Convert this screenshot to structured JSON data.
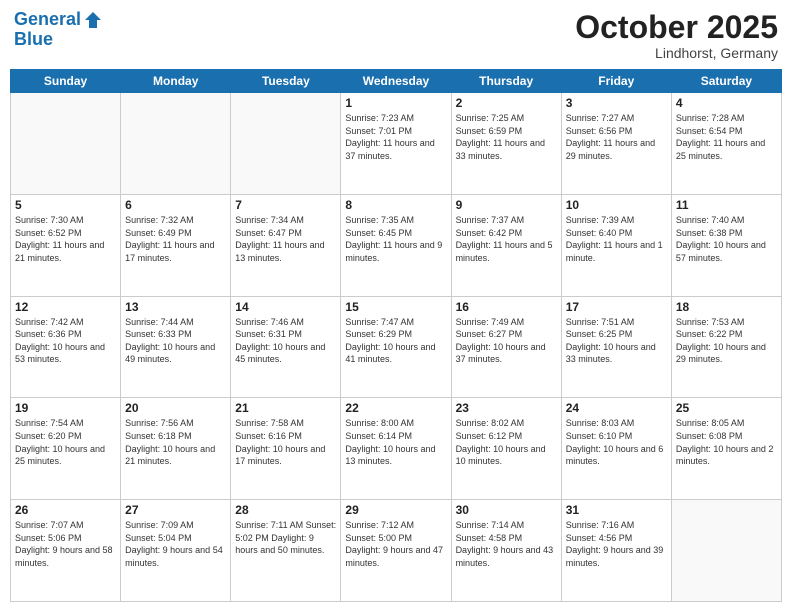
{
  "header": {
    "logo_line1": "General",
    "logo_line2": "Blue",
    "month": "October 2025",
    "location": "Lindhorst, Germany"
  },
  "days_of_week": [
    "Sunday",
    "Monday",
    "Tuesday",
    "Wednesday",
    "Thursday",
    "Friday",
    "Saturday"
  ],
  "weeks": [
    [
      {
        "day": "",
        "info": ""
      },
      {
        "day": "",
        "info": ""
      },
      {
        "day": "",
        "info": ""
      },
      {
        "day": "1",
        "info": "Sunrise: 7:23 AM\nSunset: 7:01 PM\nDaylight: 11 hours\nand 37 minutes."
      },
      {
        "day": "2",
        "info": "Sunrise: 7:25 AM\nSunset: 6:59 PM\nDaylight: 11 hours\nand 33 minutes."
      },
      {
        "day": "3",
        "info": "Sunrise: 7:27 AM\nSunset: 6:56 PM\nDaylight: 11 hours\nand 29 minutes."
      },
      {
        "day": "4",
        "info": "Sunrise: 7:28 AM\nSunset: 6:54 PM\nDaylight: 11 hours\nand 25 minutes."
      }
    ],
    [
      {
        "day": "5",
        "info": "Sunrise: 7:30 AM\nSunset: 6:52 PM\nDaylight: 11 hours\nand 21 minutes."
      },
      {
        "day": "6",
        "info": "Sunrise: 7:32 AM\nSunset: 6:49 PM\nDaylight: 11 hours\nand 17 minutes."
      },
      {
        "day": "7",
        "info": "Sunrise: 7:34 AM\nSunset: 6:47 PM\nDaylight: 11 hours\nand 13 minutes."
      },
      {
        "day": "8",
        "info": "Sunrise: 7:35 AM\nSunset: 6:45 PM\nDaylight: 11 hours\nand 9 minutes."
      },
      {
        "day": "9",
        "info": "Sunrise: 7:37 AM\nSunset: 6:42 PM\nDaylight: 11 hours\nand 5 minutes."
      },
      {
        "day": "10",
        "info": "Sunrise: 7:39 AM\nSunset: 6:40 PM\nDaylight: 11 hours\nand 1 minute."
      },
      {
        "day": "11",
        "info": "Sunrise: 7:40 AM\nSunset: 6:38 PM\nDaylight: 10 hours\nand 57 minutes."
      }
    ],
    [
      {
        "day": "12",
        "info": "Sunrise: 7:42 AM\nSunset: 6:36 PM\nDaylight: 10 hours\nand 53 minutes."
      },
      {
        "day": "13",
        "info": "Sunrise: 7:44 AM\nSunset: 6:33 PM\nDaylight: 10 hours\nand 49 minutes."
      },
      {
        "day": "14",
        "info": "Sunrise: 7:46 AM\nSunset: 6:31 PM\nDaylight: 10 hours\nand 45 minutes."
      },
      {
        "day": "15",
        "info": "Sunrise: 7:47 AM\nSunset: 6:29 PM\nDaylight: 10 hours\nand 41 minutes."
      },
      {
        "day": "16",
        "info": "Sunrise: 7:49 AM\nSunset: 6:27 PM\nDaylight: 10 hours\nand 37 minutes."
      },
      {
        "day": "17",
        "info": "Sunrise: 7:51 AM\nSunset: 6:25 PM\nDaylight: 10 hours\nand 33 minutes."
      },
      {
        "day": "18",
        "info": "Sunrise: 7:53 AM\nSunset: 6:22 PM\nDaylight: 10 hours\nand 29 minutes."
      }
    ],
    [
      {
        "day": "19",
        "info": "Sunrise: 7:54 AM\nSunset: 6:20 PM\nDaylight: 10 hours\nand 25 minutes."
      },
      {
        "day": "20",
        "info": "Sunrise: 7:56 AM\nSunset: 6:18 PM\nDaylight: 10 hours\nand 21 minutes."
      },
      {
        "day": "21",
        "info": "Sunrise: 7:58 AM\nSunset: 6:16 PM\nDaylight: 10 hours\nand 17 minutes."
      },
      {
        "day": "22",
        "info": "Sunrise: 8:00 AM\nSunset: 6:14 PM\nDaylight: 10 hours\nand 13 minutes."
      },
      {
        "day": "23",
        "info": "Sunrise: 8:02 AM\nSunset: 6:12 PM\nDaylight: 10 hours\nand 10 minutes."
      },
      {
        "day": "24",
        "info": "Sunrise: 8:03 AM\nSunset: 6:10 PM\nDaylight: 10 hours\nand 6 minutes."
      },
      {
        "day": "25",
        "info": "Sunrise: 8:05 AM\nSunset: 6:08 PM\nDaylight: 10 hours\nand 2 minutes."
      }
    ],
    [
      {
        "day": "26",
        "info": "Sunrise: 7:07 AM\nSunset: 5:06 PM\nDaylight: 9 hours\nand 58 minutes."
      },
      {
        "day": "27",
        "info": "Sunrise: 7:09 AM\nSunset: 5:04 PM\nDaylight: 9 hours\nand 54 minutes."
      },
      {
        "day": "28",
        "info": "Sunrise: 7:11 AM\nSunset: 5:02 PM\nDaylight: 9 hours\nand 50 minutes."
      },
      {
        "day": "29",
        "info": "Sunrise: 7:12 AM\nSunset: 5:00 PM\nDaylight: 9 hours\nand 47 minutes."
      },
      {
        "day": "30",
        "info": "Sunrise: 7:14 AM\nSunset: 4:58 PM\nDaylight: 9 hours\nand 43 minutes."
      },
      {
        "day": "31",
        "info": "Sunrise: 7:16 AM\nSunset: 4:56 PM\nDaylight: 9 hours\nand 39 minutes."
      },
      {
        "day": "",
        "info": ""
      }
    ]
  ]
}
